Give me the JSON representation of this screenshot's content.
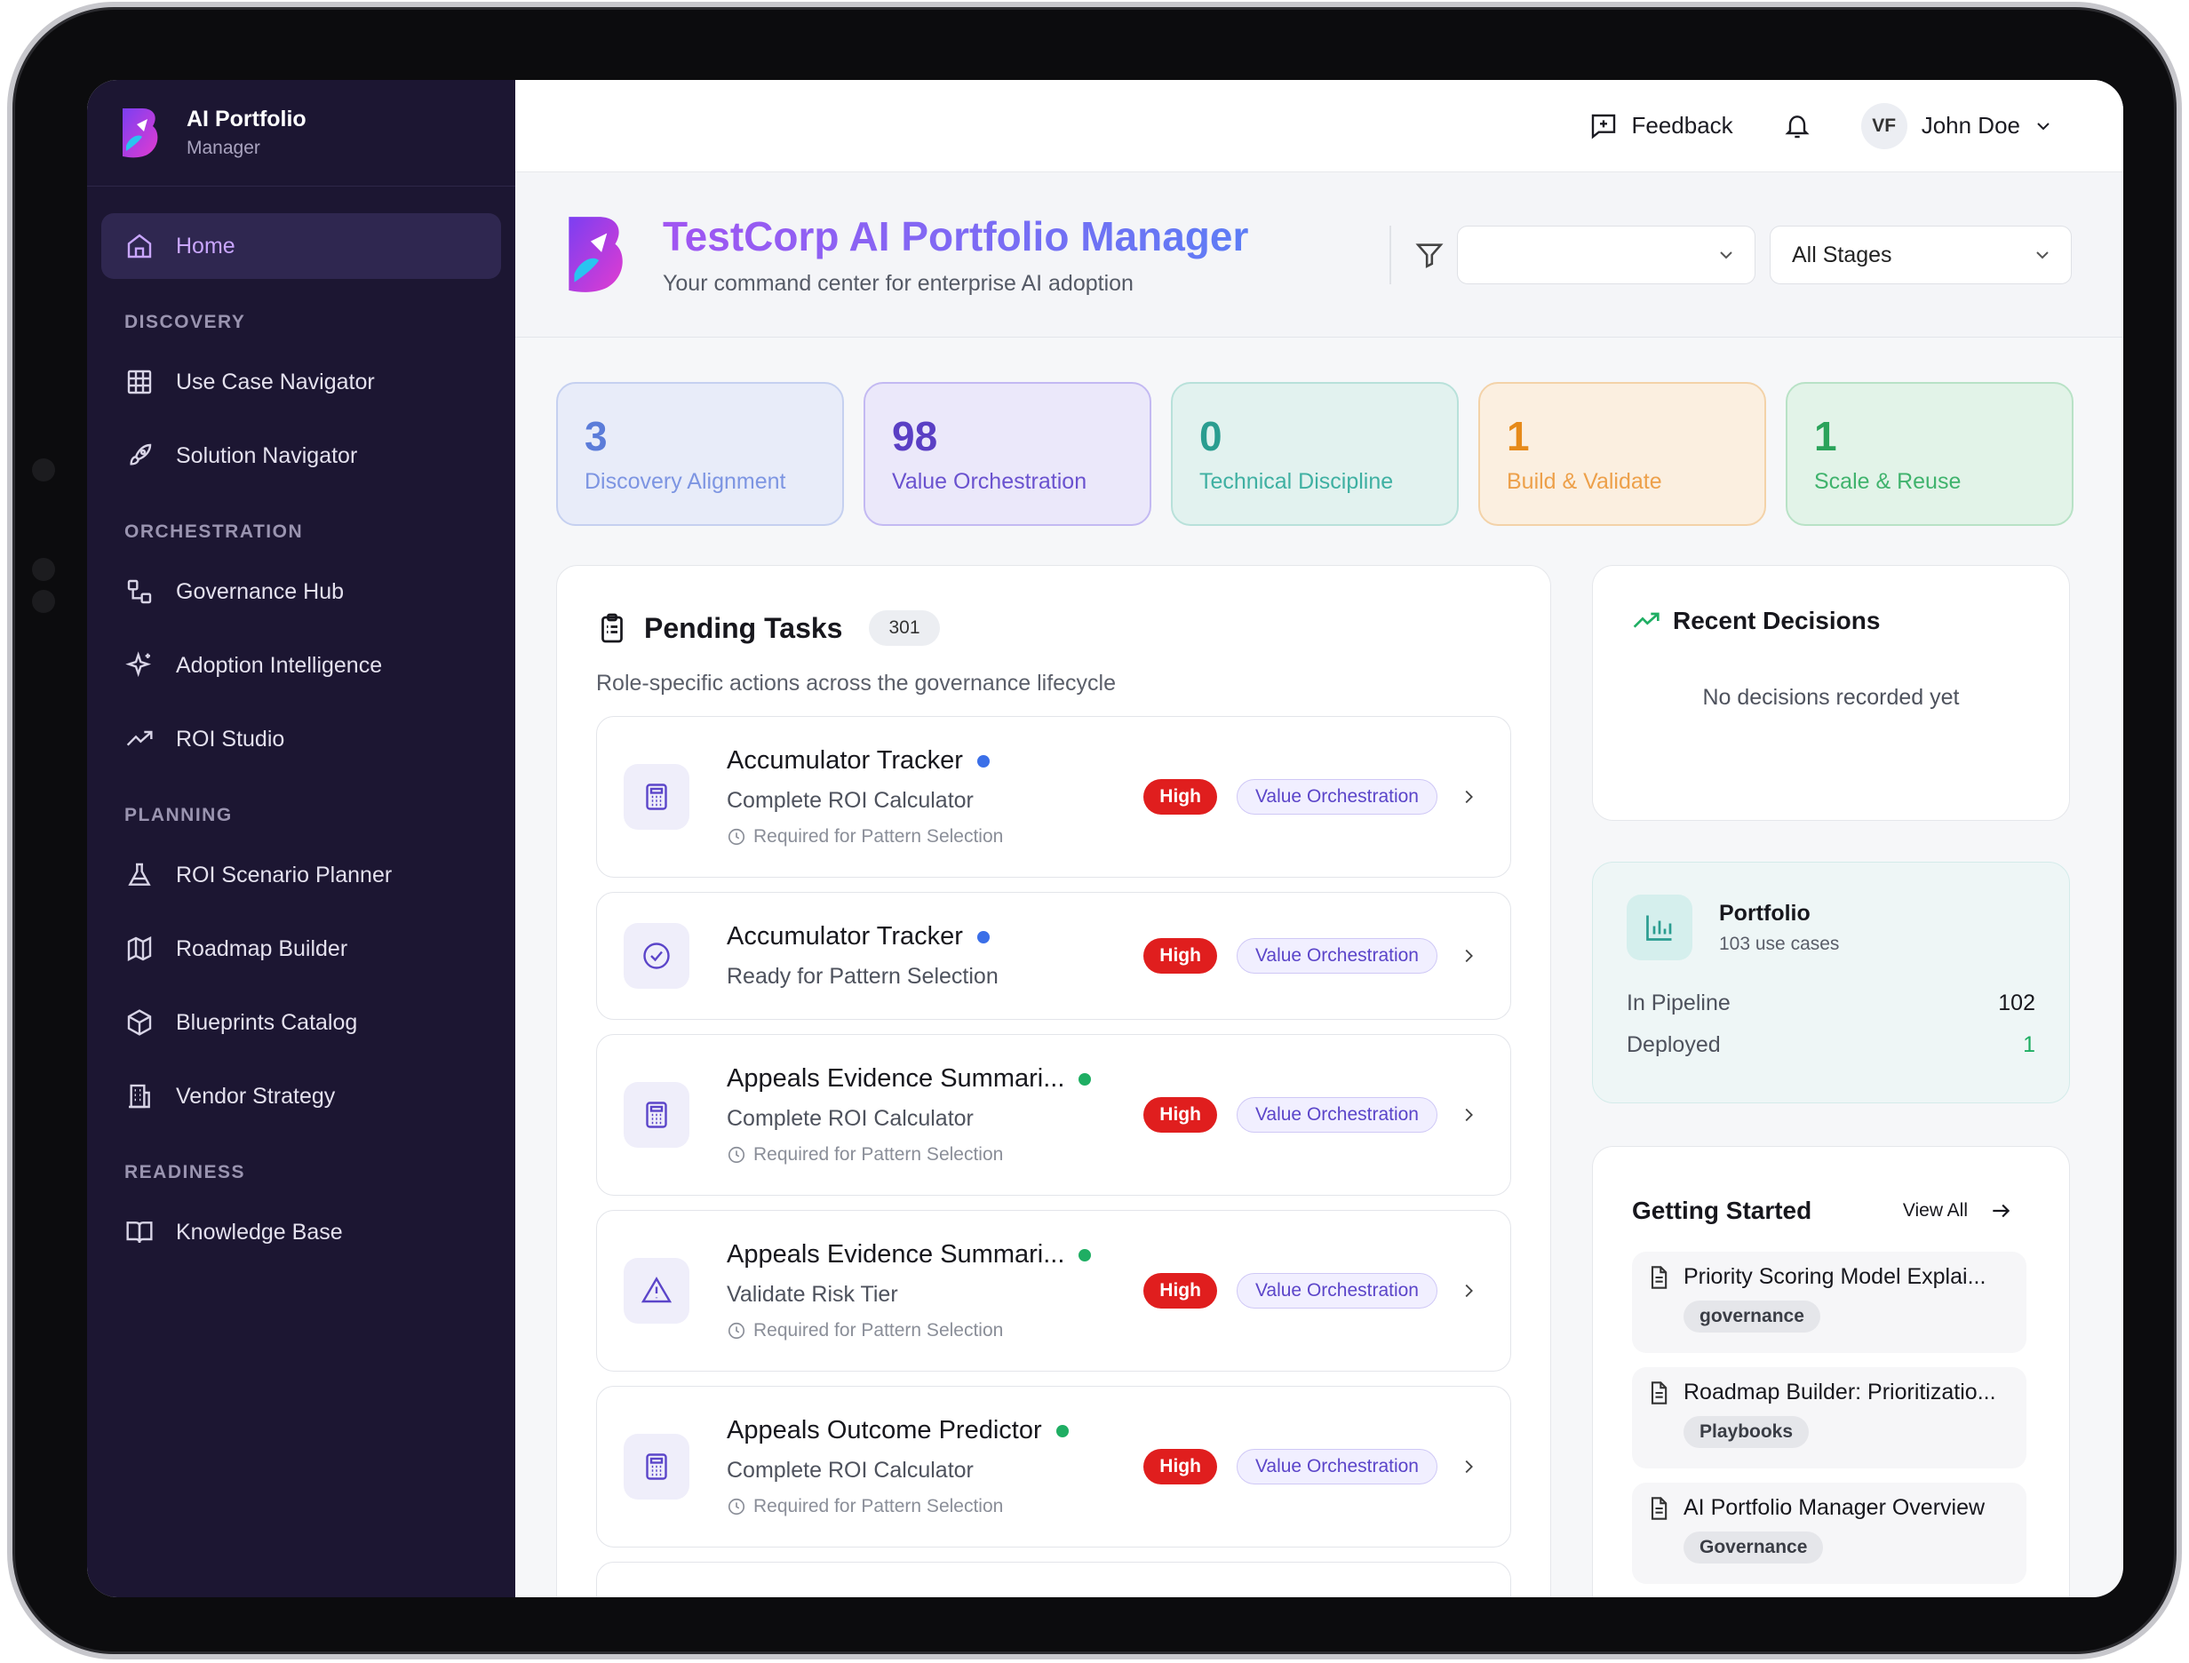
{
  "brand": {
    "name": "AI Portfolio",
    "sub": "Manager"
  },
  "nav": {
    "home": "Home",
    "sections": {
      "discovery": "DISCOVERY",
      "orchestration": "ORCHESTRATION",
      "planning": "PLANNING",
      "readiness": "READINESS"
    },
    "items": {
      "use_case_navigator": "Use Case Navigator",
      "solution_navigator": "Solution Navigator",
      "governance_hub": "Governance Hub",
      "adoption_intelligence": "Adoption Intelligence",
      "roi_studio": "ROI Studio",
      "roi_scenario_planner": "ROI Scenario Planner",
      "roadmap_builder": "Roadmap Builder",
      "blueprints_catalog": "Blueprints Catalog",
      "vendor_strategy": "Vendor Strategy",
      "knowledge_base": "Knowledge Base"
    }
  },
  "topbar": {
    "feedback": "Feedback",
    "user_initials": "VF",
    "user_name": "John Doe"
  },
  "header": {
    "title": "TestCorp AI Portfolio Manager",
    "subtitle": "Your command center for enterprise AI adoption",
    "filter_1": "",
    "filter_2": "All Stages"
  },
  "stats": [
    {
      "value": "3",
      "label": "Discovery Alignment",
      "color": "#5b7cd9"
    },
    {
      "value": "98",
      "label": "Value Orchestration",
      "color": "#5a3fc4"
    },
    {
      "value": "0",
      "label": "Technical Discipline",
      "color": "#2a9d90"
    },
    {
      "value": "1",
      "label": "Build & Validate",
      "color": "#e68a1a"
    },
    {
      "value": "1",
      "label": "Scale & Reuse",
      "color": "#2aa35a"
    }
  ],
  "tasks": {
    "title": "Pending Tasks",
    "count": "301",
    "subtitle": "Role-specific actions across the governance lifecycle",
    "items": [
      {
        "name": "Accumulator Tracker",
        "step": "Complete ROI Calculator",
        "req": "Required for Pattern Selection",
        "priority": "High",
        "stage": "Value Orchestration",
        "icon": "calculator-icon",
        "dot": "#3b6fe8"
      },
      {
        "name": "Accumulator Tracker",
        "step": "Ready for Pattern Selection",
        "req": "",
        "priority": "High",
        "stage": "Value Orchestration",
        "icon": "check-circle-icon",
        "dot": "#3b6fe8"
      },
      {
        "name": "Appeals Evidence Summari...",
        "step": "Complete ROI Calculator",
        "req": "Required for Pattern Selection",
        "priority": "High",
        "stage": "Value Orchestration",
        "icon": "calculator-icon",
        "dot": "#1fae63"
      },
      {
        "name": "Appeals Evidence Summari...",
        "step": "Validate Risk Tier",
        "req": "Required for Pattern Selection",
        "priority": "High",
        "stage": "Value Orchestration",
        "icon": "warning-icon",
        "dot": "#1fae63"
      },
      {
        "name": "Appeals Outcome Predictor",
        "step": "Complete ROI Calculator",
        "req": "Required for Pattern Selection",
        "priority": "High",
        "stage": "Value Orchestration",
        "icon": "calculator-icon",
        "dot": "#1fae63"
      }
    ]
  },
  "decisions": {
    "title": "Recent Decisions",
    "empty": "No decisions recorded yet"
  },
  "portfolio": {
    "title": "Portfolio",
    "sub": "103 use cases",
    "pipeline_label": "In Pipeline",
    "pipeline_value": "102",
    "deployed_label": "Deployed",
    "deployed_value": "1"
  },
  "getting_started": {
    "title": "Getting Started",
    "view_all": "View All",
    "docs": [
      {
        "title": "Priority Scoring Model Explai...",
        "tag": "governance"
      },
      {
        "title": "Roadmap Builder: Prioritizatio...",
        "tag": "Playbooks"
      },
      {
        "title": "AI Portfolio Manager Overview",
        "tag": "Governance"
      }
    ]
  }
}
